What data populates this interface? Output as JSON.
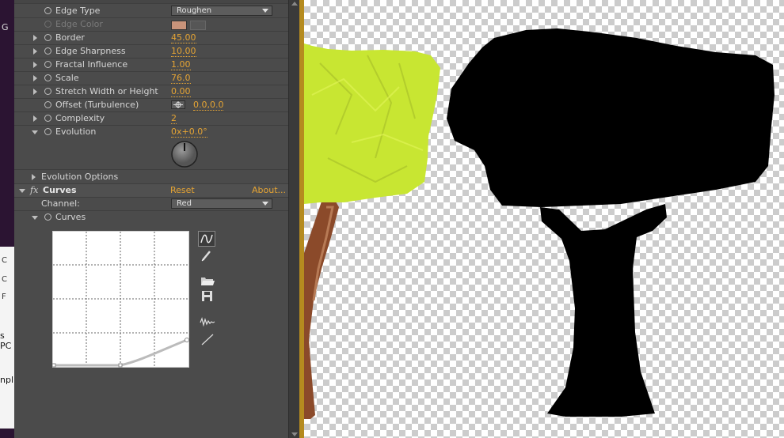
{
  "left_fragments": [
    "G",
    "C",
    "C",
    "F",
    "s PC",
    "npl"
  ],
  "effects": {
    "roughen": {
      "edge_type_label": "Edge Type",
      "edge_type_value": "Roughen",
      "edge_color_label": "Edge Color",
      "edge_color_swatch": "#c8937a",
      "params": [
        {
          "label": "Border",
          "value": "45.00"
        },
        {
          "label": "Edge Sharpness",
          "value": "10.00"
        },
        {
          "label": "Fractal Influence",
          "value": "1.00"
        },
        {
          "label": "Scale",
          "value": "76.0"
        },
        {
          "label": "Stretch Width or Height",
          "value": "0.00"
        },
        {
          "label": "Offset (Turbulence)",
          "value": "0.0,0.0"
        },
        {
          "label": "Complexity",
          "value": "2"
        },
        {
          "label": "Evolution",
          "value": "0x+0.0°"
        }
      ],
      "evolution_options_label": "Evolution Options"
    },
    "curves": {
      "fx_label": "fx",
      "name": "Curves",
      "reset": "Reset",
      "about": "About...",
      "channel_label": "Channel:",
      "channel_value": "Red",
      "curves_label": "Curves"
    }
  },
  "colors": {
    "panel_bg": "#4b4b4b",
    "accent": "#e5a434",
    "tree_crown": "#c8e632",
    "trunk_brown": "#8b4a2a"
  },
  "icons": [
    "smooth-curve-icon",
    "pencil-icon",
    "folder-open-icon",
    "save-icon",
    "wave-icon",
    "diagonal-line-icon"
  ]
}
